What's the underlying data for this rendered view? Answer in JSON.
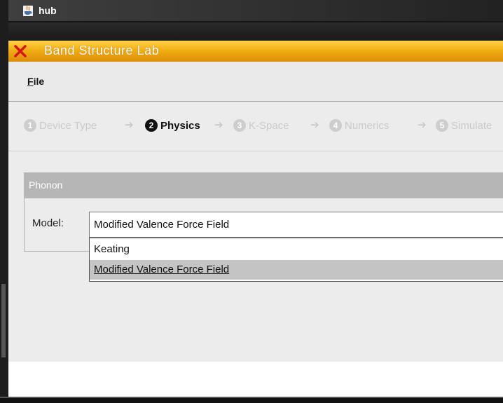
{
  "window": {
    "title": "hub",
    "icon": "java-icon"
  },
  "app": {
    "title": "Band Structure Lab",
    "close_icon": "close-icon",
    "accent": "#f2ae14"
  },
  "menu": {
    "file_label_rest": "ile",
    "file_mnemonic": "F"
  },
  "steps": [
    {
      "num": "1",
      "label": "Device Type",
      "active": false
    },
    {
      "num": "2",
      "label": "Physics",
      "active": true
    },
    {
      "num": "3",
      "label": "K-Space",
      "active": false
    },
    {
      "num": "4",
      "label": "Numerics",
      "active": false
    },
    {
      "num": "5",
      "label": "Simulate",
      "active": false
    }
  ],
  "panel": {
    "title": "Phonon"
  },
  "model": {
    "label": "Model:",
    "value": "Modified Valence Force Field",
    "options": [
      "Keating",
      "Modified Valence Force Field"
    ],
    "selected_index": 1
  }
}
